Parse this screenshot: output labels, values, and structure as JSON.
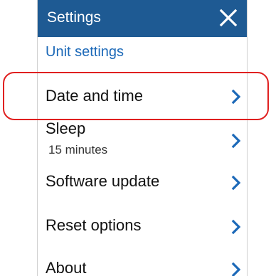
{
  "window": {
    "title": "Settings",
    "close_icon": "close-icon"
  },
  "section": {
    "label": "Unit settings"
  },
  "items": [
    {
      "label": "Date and time",
      "sublabel": "",
      "icon": "chevron-right-icon"
    },
    {
      "label": "Sleep",
      "sublabel": "15 minutes",
      "icon": "chevron-right-icon"
    },
    {
      "label": "Software update",
      "sublabel": "",
      "icon": "chevron-right-icon"
    },
    {
      "label": "Reset options",
      "sublabel": "",
      "icon": "chevron-right-icon"
    },
    {
      "label": "About",
      "sublabel": "",
      "icon": "chevron-right-icon"
    }
  ],
  "colors": {
    "titlebar": "#1e5a93",
    "accent": "#1c69b8",
    "highlight": "#e02020"
  }
}
